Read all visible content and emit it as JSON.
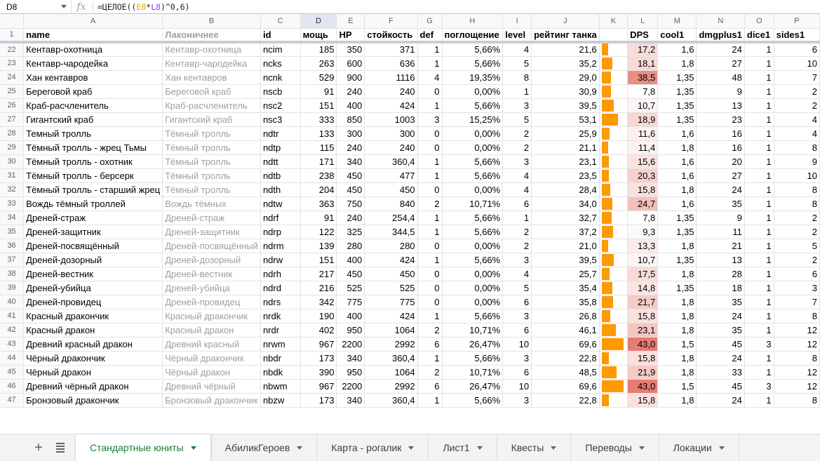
{
  "formula_bar": {
    "cell_ref": "D8",
    "fx": "fx",
    "formula": [
      "=ЦЕЛОЕ((",
      "E8",
      "*",
      "L8",
      ")^0,6)"
    ]
  },
  "columns": [
    "A",
    "B",
    "C",
    "D",
    "E",
    "F",
    "G",
    "H",
    "I",
    "J",
    "K",
    "L",
    "M",
    "N",
    "O",
    "P"
  ],
  "selected_column": "D",
  "header_row": {
    "num": "1",
    "cells": [
      "name",
      "Лаконичнее",
      "id",
      "мощь",
      "HP",
      "стойкость",
      "def",
      "поглощение",
      "level",
      "рейтинг танка",
      "",
      "DPS",
      "cool1",
      "dmgplus1",
      "dice1",
      "sides1"
    ]
  },
  "rows": [
    {
      "num": "22",
      "cells": [
        "Кентавр-охотница",
        "Кентавр-охотница",
        "ncim",
        "185",
        "350",
        "371",
        "1",
        "5,66%",
        "4",
        "21,6",
        "",
        "17,2",
        "1,6",
        "24",
        "1",
        "6"
      ],
      "tank": 21.6,
      "dps": 17.2
    },
    {
      "num": "23",
      "cells": [
        "Кентавр-чародейка",
        "Кентавр-чародейка",
        "ncks",
        "263",
        "600",
        "636",
        "1",
        "5,66%",
        "5",
        "35,2",
        "",
        "18,1",
        "1,8",
        "27",
        "1",
        "10"
      ],
      "tank": 35.2,
      "dps": 18.1
    },
    {
      "num": "24",
      "cells": [
        "Хан кентавров",
        "Хан кентавров",
        "ncnk",
        "529",
        "900",
        "1116",
        "4",
        "19,35%",
        "8",
        "29,0",
        "",
        "38,5",
        "1,35",
        "48",
        "1",
        "7"
      ],
      "tank": 29.0,
      "dps": 38.5
    },
    {
      "num": "25",
      "cells": [
        "Береговой краб",
        "Береговой краб",
        "nscb",
        "91",
        "240",
        "240",
        "0",
        "0,00%",
        "1",
        "30,9",
        "",
        "7,8",
        "1,35",
        "9",
        "1",
        "2"
      ],
      "tank": 30.9,
      "dps": 7.8
    },
    {
      "num": "26",
      "cells": [
        "Краб-расчленитель",
        "Краб-расчленитель",
        "nsc2",
        "151",
        "400",
        "424",
        "1",
        "5,66%",
        "3",
        "39,5",
        "",
        "10,7",
        "1,35",
        "13",
        "1",
        "2"
      ],
      "tank": 39.5,
      "dps": 10.7
    },
    {
      "num": "27",
      "cells": [
        "Гигантский краб",
        "Гигантский краб",
        "nsc3",
        "333",
        "850",
        "1003",
        "3",
        "15,25%",
        "5",
        "53,1",
        "",
        "18,9",
        "1,35",
        "23",
        "1",
        "4"
      ],
      "tank": 53.1,
      "dps": 18.9
    },
    {
      "num": "28",
      "cells": [
        "Темный тролль",
        "Тёмный тролль",
        "ndtr",
        "133",
        "300",
        "300",
        "0",
        "0,00%",
        "2",
        "25,9",
        "",
        "11,6",
        "1,6",
        "16",
        "1",
        "4"
      ],
      "tank": 25.9,
      "dps": 11.6
    },
    {
      "num": "29",
      "cells": [
        "Тёмный тролль - жрец Тьмы",
        "Тёмный тролль",
        "ndtp",
        "115",
        "240",
        "240",
        "0",
        "0,00%",
        "2",
        "21,1",
        "",
        "11,4",
        "1,8",
        "16",
        "1",
        "8"
      ],
      "tank": 21.1,
      "dps": 11.4
    },
    {
      "num": "30",
      "cells": [
        "Тёмный тролль - охотник",
        "Тёмный тролль",
        "ndtt",
        "171",
        "340",
        "360,4",
        "1",
        "5,66%",
        "3",
        "23,1",
        "",
        "15,6",
        "1,6",
        "20",
        "1",
        "9"
      ],
      "tank": 23.1,
      "dps": 15.6
    },
    {
      "num": "31",
      "cells": [
        "Тёмный тролль - берсерк",
        "Тёмный тролль",
        "ndtb",
        "238",
        "450",
        "477",
        "1",
        "5,66%",
        "4",
        "23,5",
        "",
        "20,3",
        "1,6",
        "27",
        "1",
        "10"
      ],
      "tank": 23.5,
      "dps": 20.3
    },
    {
      "num": "32",
      "cells": [
        "Тёмный тролль - старший жрец",
        "Тёмный тролль",
        "ndth",
        "204",
        "450",
        "450",
        "0",
        "0,00%",
        "4",
        "28,4",
        "",
        "15,8",
        "1,8",
        "24",
        "1",
        "8"
      ],
      "tank": 28.4,
      "dps": 15.8
    },
    {
      "num": "33",
      "cells": [
        "Вождь тёмный троллей",
        "Вождь тёмных",
        "ndtw",
        "363",
        "750",
        "840",
        "2",
        "10,71%",
        "6",
        "34,0",
        "",
        "24,7",
        "1,6",
        "35",
        "1",
        "8"
      ],
      "tank": 34.0,
      "dps": 24.7
    },
    {
      "num": "34",
      "cells": [
        "Дреней-страж",
        "Дреней-страж",
        "ndrf",
        "91",
        "240",
        "254,4",
        "1",
        "5,66%",
        "1",
        "32,7",
        "",
        "7,8",
        "1,35",
        "9",
        "1",
        "2"
      ],
      "tank": 32.7,
      "dps": 7.8
    },
    {
      "num": "35",
      "cells": [
        "Дреней-защитник",
        "Дреней-защитник",
        "ndrp",
        "122",
        "325",
        "344,5",
        "1",
        "5,66%",
        "2",
        "37,2",
        "",
        "9,3",
        "1,35",
        "11",
        "1",
        "2"
      ],
      "tank": 37.2,
      "dps": 9.3
    },
    {
      "num": "36",
      "cells": [
        "Дреней-посвящённый",
        "Дреней-посвящённый",
        "ndrm",
        "139",
        "280",
        "280",
        "0",
        "0,00%",
        "2",
        "21,0",
        "",
        "13,3",
        "1,8",
        "21",
        "1",
        "5"
      ],
      "tank": 21.0,
      "dps": 13.3
    },
    {
      "num": "37",
      "cells": [
        "Дреней-дозорный",
        "Дреней-дозорный",
        "ndrw",
        "151",
        "400",
        "424",
        "1",
        "5,66%",
        "3",
        "39,5",
        "",
        "10,7",
        "1,35",
        "13",
        "1",
        "2"
      ],
      "tank": 39.5,
      "dps": 10.7
    },
    {
      "num": "38",
      "cells": [
        "Дреней-вестник",
        "Дреней-вестник",
        "ndrh",
        "217",
        "450",
        "450",
        "0",
        "0,00%",
        "4",
        "25,7",
        "",
        "17,5",
        "1,8",
        "28",
        "1",
        "6"
      ],
      "tank": 25.7,
      "dps": 17.5
    },
    {
      "num": "39",
      "cells": [
        "Дреней-убийца",
        "Дреней-убийца",
        "ndrd",
        "216",
        "525",
        "525",
        "0",
        "0,00%",
        "5",
        "35,4",
        "",
        "14,8",
        "1,35",
        "18",
        "1",
        "3"
      ],
      "tank": 35.4,
      "dps": 14.8
    },
    {
      "num": "40",
      "cells": [
        "Дреней-провидец",
        "Дреней-провидец",
        "ndrs",
        "342",
        "775",
        "775",
        "0",
        "0,00%",
        "6",
        "35,8",
        "",
        "21,7",
        "1,8",
        "35",
        "1",
        "7"
      ],
      "tank": 35.8,
      "dps": 21.7
    },
    {
      "num": "41",
      "cells": [
        "Красный дракончик",
        "Красный дракончик",
        "nrdk",
        "190",
        "400",
        "424",
        "1",
        "5,66%",
        "3",
        "26,8",
        "",
        "15,8",
        "1,8",
        "24",
        "1",
        "8"
      ],
      "tank": 26.8,
      "dps": 15.8
    },
    {
      "num": "42",
      "cells": [
        "Красный дракон",
        "Красный дракон",
        "nrdr",
        "402",
        "950",
        "1064",
        "2",
        "10,71%",
        "6",
        "46,1",
        "",
        "23,1",
        "1,8",
        "35",
        "1",
        "12"
      ],
      "tank": 46.1,
      "dps": 23.1
    },
    {
      "num": "43",
      "cells": [
        "Древний красный дракон",
        "Древний красный",
        "nrwm",
        "967",
        "2200",
        "2992",
        "6",
        "26,47%",
        "10",
        "69,6",
        "",
        "43,0",
        "1,5",
        "45",
        "3",
        "12"
      ],
      "tank": 69.6,
      "dps": 43.0
    },
    {
      "num": "44",
      "cells": [
        "Чёрный дракончик",
        "Чёрный дракончик",
        "nbdr",
        "173",
        "340",
        "360,4",
        "1",
        "5,66%",
        "3",
        "22,8",
        "",
        "15,8",
        "1,8",
        "24",
        "1",
        "8"
      ],
      "tank": 22.8,
      "dps": 15.8
    },
    {
      "num": "45",
      "cells": [
        "Чёрный дракон",
        "Чёрный дракон",
        "nbdk",
        "390",
        "950",
        "1064",
        "2",
        "10,71%",
        "6",
        "48,5",
        "",
        "21,9",
        "1,8",
        "33",
        "1",
        "12"
      ],
      "tank": 48.5,
      "dps": 21.9
    },
    {
      "num": "46",
      "cells": [
        "Древний чёрный дракон",
        "Древний чёрный",
        "nbwm",
        "967",
        "2200",
        "2992",
        "6",
        "26,47%",
        "10",
        "69,6",
        "",
        "43,0",
        "1,5",
        "45",
        "3",
        "12"
      ],
      "tank": 69.6,
      "dps": 43.0
    },
    {
      "num": "47",
      "cells": [
        "Бронзовый дракончик",
        "Бронзовый дракончик",
        "nbzw",
        "173",
        "340",
        "360,4",
        "1",
        "5,66%",
        "3",
        "22,8",
        "",
        "15,8",
        "1,8",
        "24",
        "1",
        "8"
      ],
      "tank": 22.8,
      "dps": 15.8
    }
  ],
  "tank_scale_max": 75,
  "dps_scale_min": 7.8,
  "dps_scale_max": 43.0,
  "colors": {
    "bar": "#ff9900",
    "heat_low": "#ffffff",
    "heat_high": "#e67c73",
    "active_tab": "#188038"
  },
  "sheet_tabs": [
    "Стандартные юниты",
    "АбиликГероев",
    "Карта - рогалик",
    "Лист1",
    "Квесты",
    "Переводы",
    "Локации"
  ],
  "active_tab": 0
}
